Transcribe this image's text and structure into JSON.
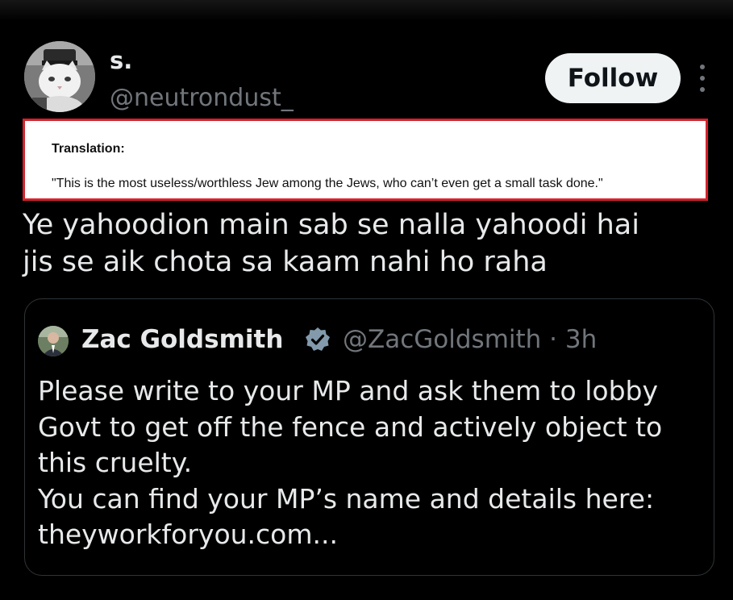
{
  "colors": {
    "background": "#000000",
    "primary_text": "#e7e9ea",
    "secondary_text": "#71767b",
    "follow_button_bg": "#eff3f4",
    "follow_button_text": "#0f1419",
    "translation_border": "#d5222c",
    "verified_badge": "#829aab",
    "card_border": "#2f3336"
  },
  "author": {
    "display_name": "s.",
    "handle": "@neutrondust_",
    "avatar_icon": "cat-avatar-icon"
  },
  "actions": {
    "follow_label": "Follow",
    "more_icon": "more-vertical-icon"
  },
  "translation": {
    "title": "Translation:",
    "text": "\"This is the most useless/worthless Jew among the Jews, who can’t even get a small task done.\""
  },
  "tweet": {
    "lines": [
      "Ye yahoodion main sab se nalla yahoodi hai",
      "jis se aik chota sa kaam nahi ho raha"
    ]
  },
  "quoted": {
    "display_name": "Zac Goldsmith",
    "verified_icon": "verified-badge-icon",
    "handle_time": "@ZacGoldsmith · 3h",
    "body_lines": [
      "Please write to your MP and ask them to lobby",
      "Govt to get off the fence and actively object to",
      "this cruelty.",
      "You can find your MP’s name and details here:",
      "theyworkforyou.com..."
    ]
  }
}
